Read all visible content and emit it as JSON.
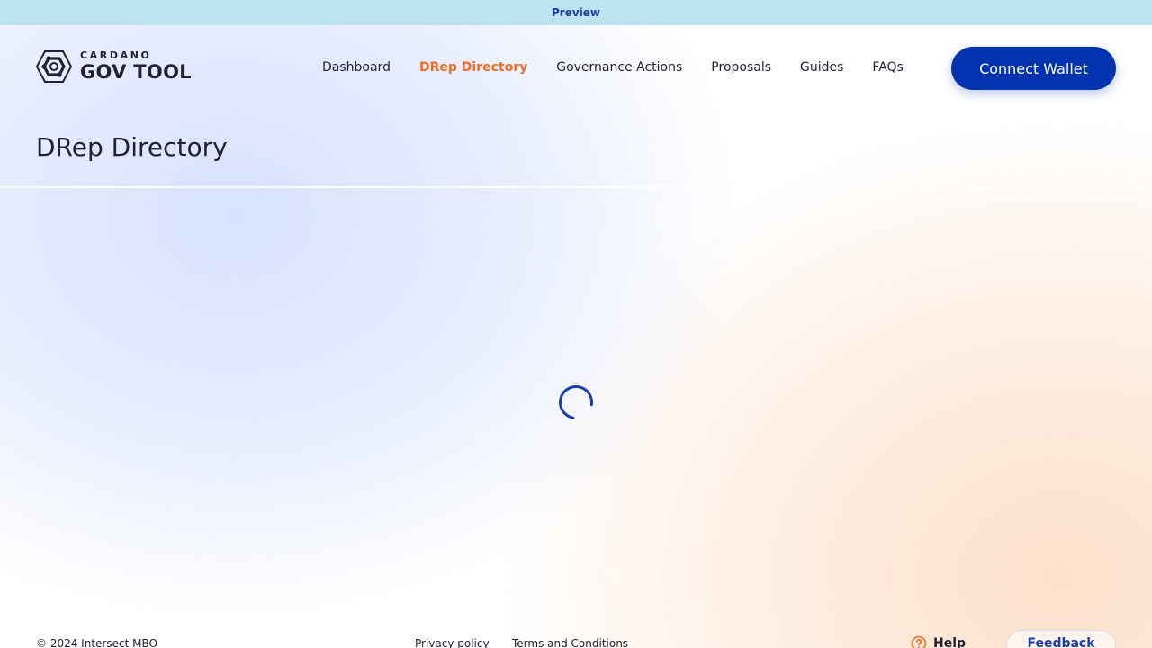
{
  "preview_bar": {
    "label": "Preview"
  },
  "logo": {
    "small": "CARDANO",
    "big": "GOV TOOL"
  },
  "nav": {
    "items": [
      {
        "label": "Dashboard",
        "active": false
      },
      {
        "label": "DRep Directory",
        "active": true
      },
      {
        "label": "Governance Actions",
        "active": false
      },
      {
        "label": "Proposals",
        "active": false
      },
      {
        "label": "Guides",
        "active": false
      },
      {
        "label": "FAQs",
        "active": false
      }
    ],
    "connect_label": "Connect Wallet"
  },
  "page": {
    "title": "DRep Directory",
    "loading": true
  },
  "footer": {
    "copyright": "© 2024 Intersect MBO",
    "privacy": "Privacy policy",
    "terms": "Terms and Conditions",
    "help": "Help",
    "feedback": "Feedback"
  },
  "colors": {
    "accent_orange": "#f26b21",
    "primary_blue": "#0033ad",
    "preview_bar": "#bde3f1",
    "text_dark": "#242232"
  },
  "icons": {
    "logo": "hexagon-logo-icon",
    "help": "question-circle-icon",
    "spinner": "loading-spinner-icon"
  }
}
